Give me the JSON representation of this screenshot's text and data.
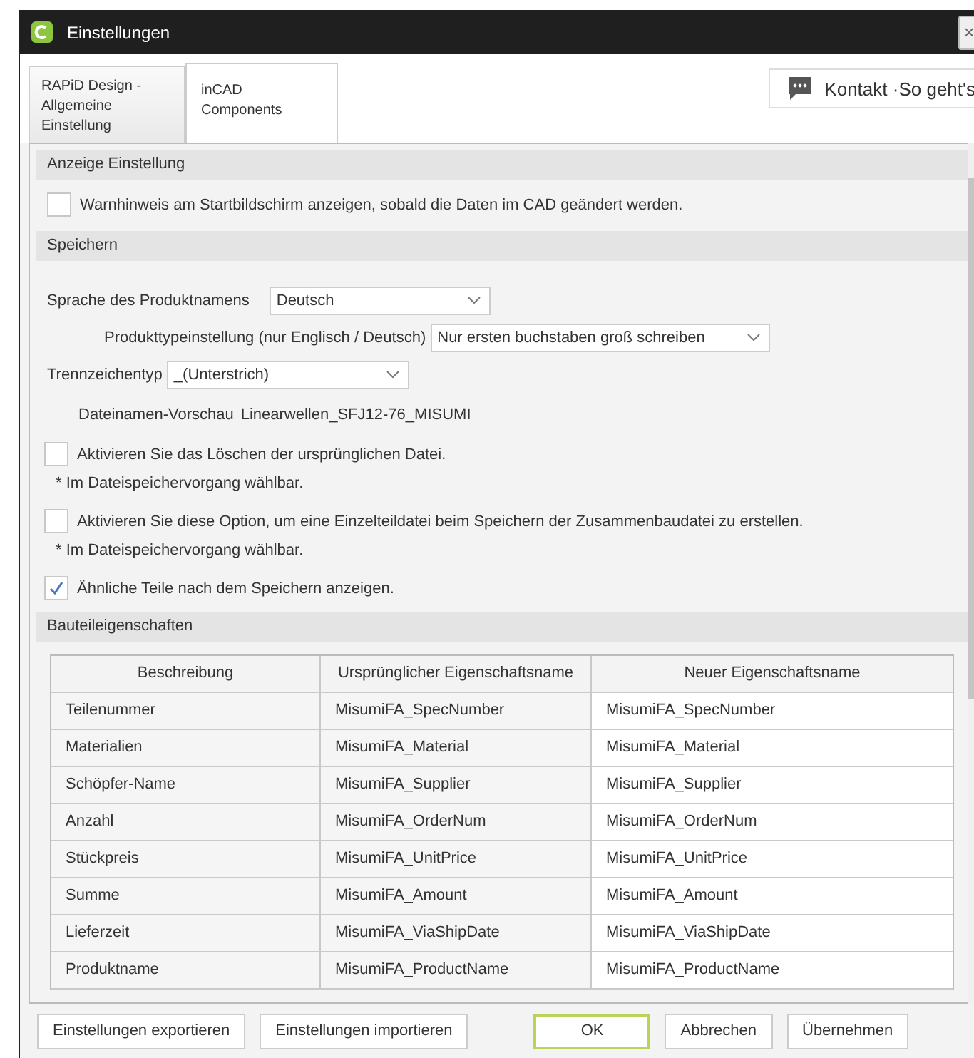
{
  "window": {
    "title": "Einstellungen",
    "close": "×"
  },
  "tabs": [
    {
      "label": "RAPiD Design - Allgemeine Einstellung",
      "selected": false
    },
    {
      "label": "inCAD Components",
      "selected": true
    }
  ],
  "contact_button": {
    "label": "Kontakt ·So geht's"
  },
  "display_section": {
    "title": "Anzeige Einstellung",
    "options": [
      {
        "label": "Warnhinweis am Startbildschirm anzeigen, sobald die Daten im CAD geändert werden.",
        "checked": false
      }
    ]
  },
  "save_section": {
    "title": "Speichern",
    "fields": [
      {
        "label": "Sprache des Produktnamens",
        "value": "Deutsch"
      },
      {
        "label": "Produkttypeinstellung (nur Englisch / Deutsch)",
        "value": "Nur ersten buchstaben groß schreiben"
      },
      {
        "label": "Trennzeichentyp",
        "value": "_(Unterstrich)"
      }
    ],
    "preview": {
      "label": "Dateinamen-Vorschau",
      "value": "Linearwellen_SFJ12-76_MISUMI"
    },
    "options": [
      {
        "label": "Aktivieren Sie das Löschen der ursprünglichen Datei.",
        "checked": false,
        "note": "* Im Dateispeichervorgang wählbar."
      },
      {
        "label": "Aktivieren Sie diese Option, um eine Einzelteildatei beim Speichern der Zusammenbaudatei zu erstellen.",
        "checked": false,
        "note": "* Im Dateispeichervorgang wählbar."
      },
      {
        "label": "Ähnliche Teile nach dem Speichern anzeigen.",
        "checked": true
      }
    ]
  },
  "properties_section": {
    "title": "Bauteileigenschaften",
    "columns": [
      "Beschreibung",
      "Ursprünglicher Eigenschaftsname",
      "Neuer Eigenschaftsname"
    ],
    "rows": [
      [
        "Teilenummer",
        "MisumiFA_SpecNumber",
        "MisumiFA_SpecNumber"
      ],
      [
        "Materialien",
        "MisumiFA_Material",
        "MisumiFA_Material"
      ],
      [
        "Schöpfer-Name",
        "MisumiFA_Supplier",
        "MisumiFA_Supplier"
      ],
      [
        "Anzahl",
        "MisumiFA_OrderNum",
        "MisumiFA_OrderNum"
      ],
      [
        "Stückpreis",
        "MisumiFA_UnitPrice",
        "MisumiFA_UnitPrice"
      ],
      [
        "Summe",
        "MisumiFA_Amount",
        "MisumiFA_Amount"
      ],
      [
        "Lieferzeit",
        "MisumiFA_ViaShipDate",
        "MisumiFA_ViaShipDate"
      ],
      [
        "Produktname",
        "MisumiFA_ProductName",
        "MisumiFA_ProductName"
      ]
    ]
  },
  "buttons": [
    {
      "label": "Einstellungen exportieren",
      "kind": "normal"
    },
    {
      "label": "Einstellungen importieren",
      "kind": "normal"
    },
    {
      "label": "OK",
      "kind": "default"
    },
    {
      "label": "Abbrechen",
      "kind": "normal"
    },
    {
      "label": "Übernehmen",
      "kind": "normal"
    }
  ]
}
